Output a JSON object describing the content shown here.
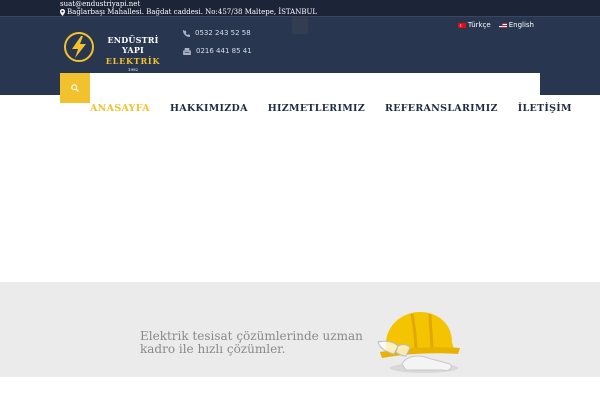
{
  "topbar": {
    "email": "suat@endustriyapi.net",
    "address": "Bağlarbaşı Mahallesi. Bağdat caddesi. No:457/38 Maltepe, İSTANBUL"
  },
  "logo": {
    "line1": "ENDÜSTRİ YAPI",
    "line2": "ELEKTRİK",
    "line3": "1992"
  },
  "contacts": {
    "mobile": "0532 243 52 58",
    "phone": "0216 441 85 41"
  },
  "languages": [
    {
      "label": "Türkçe"
    },
    {
      "label": "English"
    }
  ],
  "nav": {
    "items": [
      {
        "label": "ANASAYFA"
      },
      {
        "label": "HAKKIMIZDA"
      },
      {
        "label": "HIZMETLERIMIZ"
      },
      {
        "label": "REFERANSLARIMIZ"
      },
      {
        "label": "İLETİŞİM"
      }
    ]
  },
  "banner": {
    "tagline": "Elektrik tesisat çözümlerinde uzman kadro ile hızlı çözümler."
  },
  "colors": {
    "topbar_bg": "#1c2538",
    "header_bg": "#283650",
    "accent": "#f2c12e",
    "nav_text": "#1e2b44",
    "banner_bg": "#ebebeb"
  },
  "icons": [
    "map-pin-icon",
    "mobile-phone-icon",
    "fax-icon",
    "search-icon",
    "flag-tr-icon",
    "flag-en-icon",
    "hard-hat-icon"
  ]
}
